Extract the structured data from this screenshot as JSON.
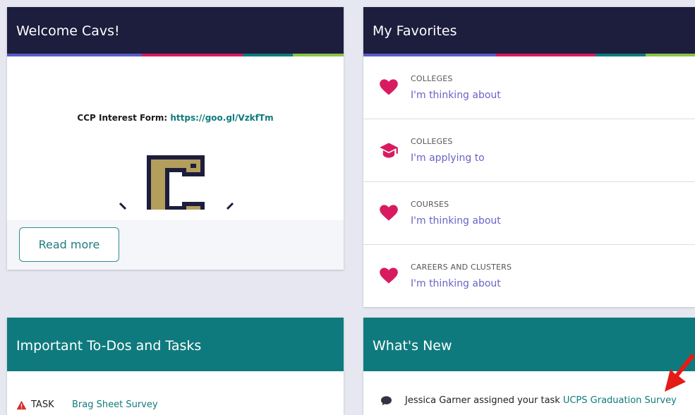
{
  "welcome": {
    "title": "Welcome Cavs!",
    "ccp_label": "CCP Interest Form:",
    "ccp_link": "https://goo.gl/VzkfTm",
    "read_more": "Read more"
  },
  "favorites": {
    "title": "My Favorites",
    "items": [
      {
        "category": "COLLEGES",
        "link": "I'm thinking about",
        "icon": "heart-icon"
      },
      {
        "category": "COLLEGES",
        "link": "I'm applying to",
        "icon": "graduation-cap-icon"
      },
      {
        "category": "COURSES",
        "link": "I'm thinking about",
        "icon": "heart-icon"
      },
      {
        "category": "CAREERS AND CLUSTERS",
        "link": "I'm thinking about",
        "icon": "heart-icon"
      }
    ]
  },
  "todos": {
    "title": "Important To-Dos and Tasks",
    "task_label": "TASK",
    "task_link": "Brag Sheet Survey"
  },
  "whats_new": {
    "title": "What's New",
    "text": "Jessica Garner assigned your task",
    "link": "UCPS Graduation Survey"
  },
  "colors": {
    "header_dark": "#1d1d3d",
    "header_teal": "#0f7a7d",
    "accent_pink": "#d81b60",
    "link_purple": "#6a63c8",
    "stripe": [
      "#5b5bc9",
      "#d81b60",
      "#0f7a7d",
      "#8bc34a"
    ]
  }
}
